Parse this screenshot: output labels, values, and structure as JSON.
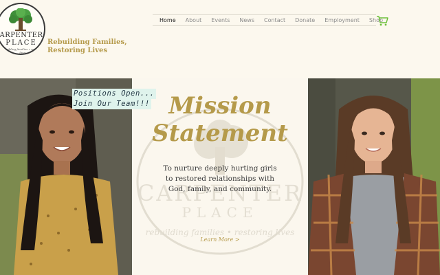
{
  "logo": {
    "name_line1": "ARPENTER",
    "name_line2": "PLACE",
    "motto": "rebuilding families • restoring lives"
  },
  "tagline": {
    "line1": "Rebuilding Families,",
    "line2": "Restoring Lives"
  },
  "nav": {
    "items": [
      {
        "label": "Home",
        "active": true
      },
      {
        "label": "About"
      },
      {
        "label": "Events"
      },
      {
        "label": "News"
      },
      {
        "label": "Contact"
      },
      {
        "label": "Donate"
      },
      {
        "label": "Employment"
      },
      {
        "label": "Shop"
      }
    ]
  },
  "hero": {
    "jobs_line1": "Positions Open...",
    "jobs_line2": "Join Our Team!!!",
    "mission_title_line1": "Mission",
    "mission_title_line2": "Statement",
    "mission_text": "To nurture deeply hurting girls to restored relationships with God, family, and community.",
    "learn_more": "Learn More >",
    "watermark_line1": "CARPENTER",
    "watermark_line2": "PLACE",
    "watermark_motto": "rebuilding families • restoring lives"
  },
  "colors": {
    "gold": "#b59a4a",
    "cream": "#fbf7ec",
    "cart_green": "#6cbf3a",
    "banner_bg": "#dff3ec"
  }
}
